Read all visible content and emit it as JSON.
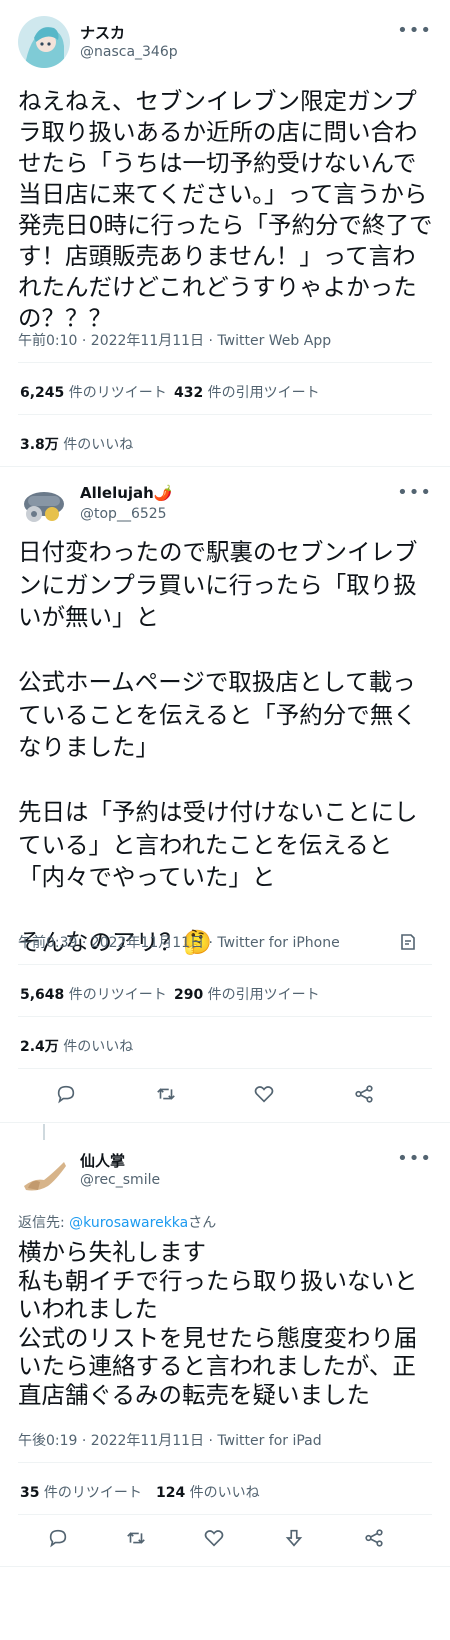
{
  "tweets": [
    {
      "name": "ナスカ",
      "handle": "@nasca_346p",
      "body": "ねえねえ、セブンイレブン限定ガンプラ取り扱いあるか近所の店に問い合わせたら「うちは一切予約受けないんで当日店に来てください。」って言うから発売日0時に行ったら「予約分で終了です！店頭販売ありません！」って言われたんだけどこれどうすりゃよかったの？？？",
      "time": "午前0:10 · 2022年11月11日 · Twitter Web App",
      "retweets": "6,245",
      "retweets_label": " 件のリツイート",
      "quotes": "432",
      "quotes_label": " 件の引用ツイート",
      "likes": "3.8万",
      "likes_label": " 件のいいね"
    },
    {
      "name": "Allelujah🌶️",
      "handle": "@top__6525",
      "body": "日付変わったので駅裏のセブンイレブンにガンプラ買いに行ったら「取り扱いが無い」と\n\n公式ホームページで取扱店として載っていることを伝えると「予約分で無くなりました」\n\n先日は「予約は受け付けないことにしている」と言われたことを伝えると「内々でやっていた」と\n\nそんなのアリ？🤔",
      "time": "午前0:39 · 2022年11月11日 · Twitter for iPhone",
      "retweets": "5,648",
      "retweets_label": " 件のリツイート",
      "quotes": "290",
      "quotes_label": " 件の引用ツイート",
      "likes": "2.4万",
      "likes_label": " 件のいいね"
    },
    {
      "name": "仙人掌",
      "handle": "@rec_smile",
      "reply_prefix": "返信先: ",
      "reply_to": "@kurosawarekka",
      "reply_suffix": "さん",
      "body": "横から失礼します\n私も朝イチで行ったら取り扱いないといわれました\n公式のリストを見せたら態度変わり届いたら連絡すると言われましたが、正直店舗ぐるみの転売を疑いました",
      "time": "午後0:19 · 2022年11月11日 · Twitter for iPad",
      "retweets": "35",
      "retweets_label": " 件のリツイート",
      "likes": "124",
      "likes_label": " 件のいいね"
    }
  ],
  "more_icon": "more-horizontal-icon",
  "colors": {
    "text": "#0f1419",
    "secondary": "#536471",
    "link": "#1d9bf0",
    "divider": "#eff3f4"
  }
}
